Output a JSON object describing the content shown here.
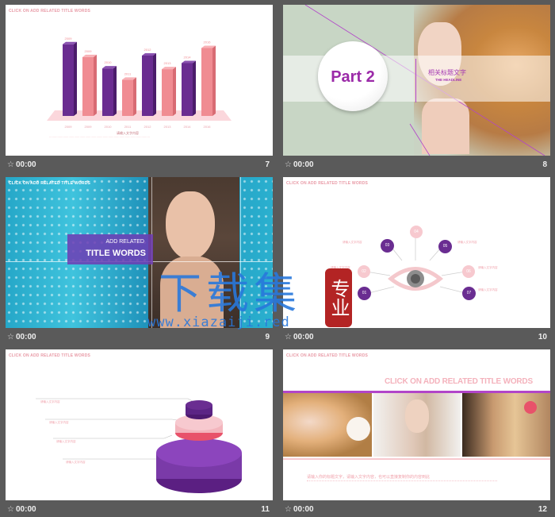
{
  "slides": [
    {
      "id": 7,
      "number": "7",
      "duration": "00:00",
      "header": "CLICK ON ADD RELATED TITLE WORDS",
      "chart_data": {
        "type": "bar",
        "categories": [
          "2009",
          "2009",
          "2010",
          "2011",
          "2012",
          "2013",
          "2014",
          "2016"
        ],
        "values": [
          95,
          78,
          63,
          48,
          80,
          62,
          70,
          90
        ],
        "value_labels": [
          "2009",
          "2009",
          "2010",
          "2011",
          "2012",
          "2013",
          "2014",
          "2016"
        ],
        "caption": "请输入文字内容",
        "colors": [
          "#6a2d91",
          "#f08c92"
        ],
        "ylim": [
          0,
          100
        ]
      }
    },
    {
      "id": 8,
      "number": "8",
      "duration": "00:00",
      "part_label": "Part 2",
      "title_cn": "相关标题文字",
      "title_en": "THE HEADLINE"
    },
    {
      "id": 9,
      "number": "9",
      "duration": "00:00",
      "header": "CLICK ON ADD RELATED TITLE WORDS",
      "sub": "ADD RELATED",
      "main": "TITLE WORDS"
    },
    {
      "id": 10,
      "number": "10",
      "duration": "00:00",
      "header": "CLICK ON ADD RELATED TITLE WORDS",
      "nodes": [
        "01",
        "02",
        "03",
        "04",
        "05",
        "06",
        "07"
      ],
      "node_caption": "请输入文字内容"
    },
    {
      "id": 11,
      "number": "11",
      "duration": "00:00",
      "header": "CLICK ON ADD RELATED TITLE WORDS",
      "tiers": [
        "请输入文字内容",
        "请输入文字内容",
        "请输入文字内容",
        "请输入文字内容"
      ]
    },
    {
      "id": 12,
      "number": "12",
      "duration": "00:00",
      "header": "CLICK ON ADD RELATED TITLE WORDS",
      "banner": "CLICK ON ADD RELATED TITLE WORDS",
      "footer_text": "请输入你的标题文字，请输入文字内容，也可以直接复制你的内容到此"
    }
  ],
  "watermark": {
    "text_main": "下载集",
    "seal": "专业",
    "url": "www.xiazaiji.red"
  },
  "colors": {
    "purple": "#6a2d91",
    "pink": "#f08c92",
    "lightpink": "#f7c9cf",
    "bg": "#5a5a5a"
  }
}
